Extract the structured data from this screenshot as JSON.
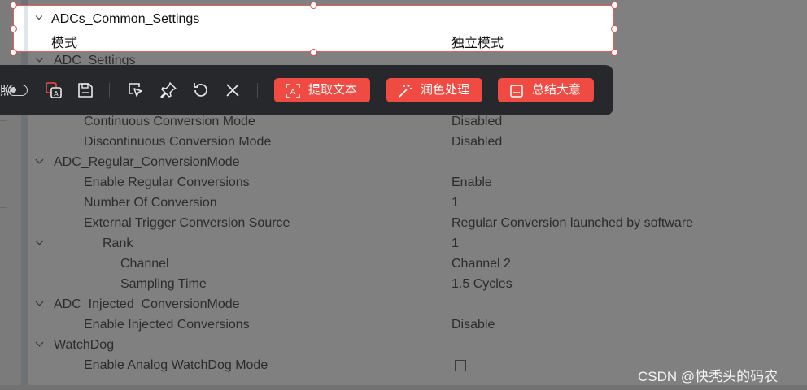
{
  "selected_row": {
    "title": "ADCs_Common_Settings",
    "mode_label": "模式",
    "mode_value": "独立模式"
  },
  "partial_header": "ADC_Settings",
  "toolbar": {
    "left_text": "照",
    "buttons": {
      "extract_text": "提取文本",
      "polish": "润色处理",
      "summarize": "总结大意"
    }
  },
  "rows": [
    {
      "label": "Continuous Conversion Mode",
      "value": "Disabled"
    },
    {
      "label": "Discontinuous Conversion Mode",
      "value": "Disabled"
    },
    {
      "label": "ADC_Regular_ConversionMode",
      "value": ""
    },
    {
      "label": "Enable Regular Conversions",
      "value": "Enable"
    },
    {
      "label": "Number Of Conversion",
      "value": "1"
    },
    {
      "label": "External Trigger Conversion Source",
      "value": "Regular Conversion launched by software"
    },
    {
      "label": "Rank",
      "value": "1"
    },
    {
      "label": "Channel",
      "value": "Channel 2"
    },
    {
      "label": "Sampling Time",
      "value": "1.5 Cycles"
    },
    {
      "label": "ADC_Injected_ConversionMode",
      "value": ""
    },
    {
      "label": "Enable Injected Conversions",
      "value": "Disable"
    },
    {
      "label": "WatchDog",
      "value": ""
    },
    {
      "label": "Enable Analog WatchDog Mode",
      "value": ""
    }
  ],
  "watermark": "CSDN @快秃头的码农",
  "colors": {
    "accent": "#f04b42",
    "toolbar_bg": "#26282c",
    "dim_bg": "#808080"
  }
}
